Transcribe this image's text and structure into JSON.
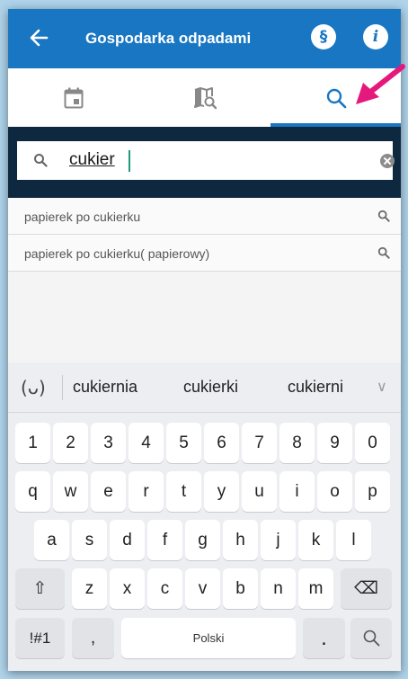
{
  "header": {
    "title": "Gospodarka odpadami",
    "law_icon": "§",
    "info_icon": "i",
    "color": "#1976c2"
  },
  "tabs": [
    {
      "icon": "calendar-icon",
      "active": false
    },
    {
      "icon": "map-search-icon",
      "active": false
    },
    {
      "icon": "search-icon",
      "active": true
    }
  ],
  "search": {
    "value": "cukier"
  },
  "results": [
    {
      "label": "papierek po cukierku"
    },
    {
      "label": "papierek po cukierku( papierowy)"
    }
  ],
  "keyboard": {
    "emoji_icon": "(ᴗ)",
    "suggestions": [
      "cukiernia",
      "cukierki",
      "cukierni"
    ],
    "expand_icon": "∨",
    "row_numbers": [
      "1",
      "2",
      "3",
      "4",
      "5",
      "6",
      "7",
      "8",
      "9",
      "0"
    ],
    "row_top": [
      "q",
      "w",
      "e",
      "r",
      "t",
      "y",
      "u",
      "i",
      "o",
      "p"
    ],
    "row_middle": [
      "a",
      "s",
      "d",
      "f",
      "g",
      "h",
      "j",
      "k",
      "l"
    ],
    "row_bottom": [
      "z",
      "x",
      "c",
      "v",
      "b",
      "n",
      "m"
    ],
    "shift_icon": "⇧",
    "backspace_icon": "⌫",
    "symbols_label": "!#1",
    "comma_label": ",",
    "space_label": "Polski",
    "period_label": ".",
    "search_key_icon": "search-icon"
  }
}
